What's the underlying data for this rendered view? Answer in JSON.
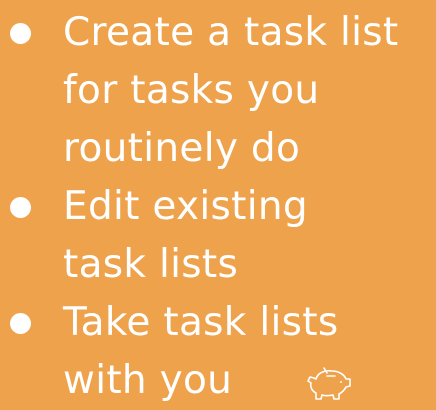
{
  "slide": {
    "bullets": [
      {
        "lines": [
          "Create a task list",
          "for tasks you",
          "routinely do"
        ]
      },
      {
        "lines": [
          "Edit existing",
          "task lists"
        ]
      },
      {
        "lines": [
          "Take task lists",
          "with you"
        ]
      }
    ]
  },
  "icons": {
    "corner_icon": "piggy-bank-icon"
  },
  "colors": {
    "background": "#EEA24C",
    "text": "#FFFFFF"
  }
}
